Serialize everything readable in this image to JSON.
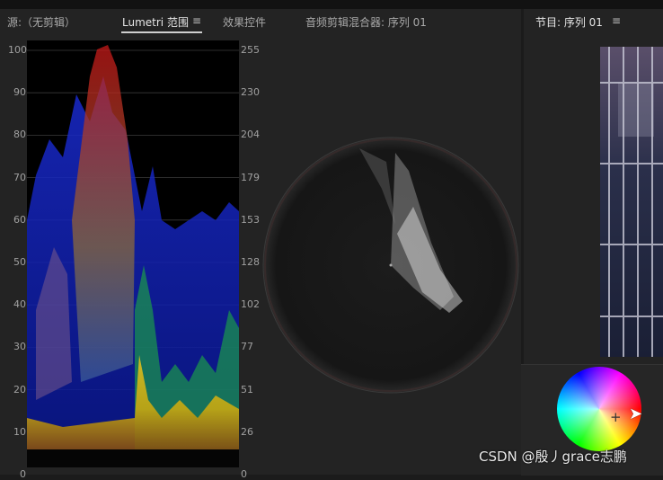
{
  "tabs": {
    "source": "源:（无剪辑）",
    "lumetri": "Lumetri 范围",
    "effect_controls": "效果控件",
    "audio_mixer": "音频剪辑混合器: 序列 01",
    "program": "节目: 序列 01",
    "menu_glyph": "≡"
  },
  "waveform": {
    "left_ticks": [
      "100",
      "90",
      "80",
      "70",
      "60",
      "50",
      "40",
      "30",
      "20",
      "10",
      "0"
    ],
    "right_ticks": [
      "255",
      "230",
      "204",
      "179",
      "153",
      "128",
      "102",
      "77",
      "51",
      "26",
      "0"
    ]
  },
  "watermark": "CSDN @殷丿grace志鹏",
  "colors": {
    "panel_bg": "#232323",
    "app_bg": "#1b1b1b",
    "text": "#b8b8b8"
  }
}
